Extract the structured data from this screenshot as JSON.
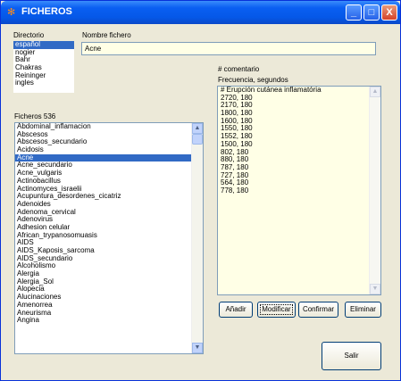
{
  "window": {
    "title": "FICHEROS",
    "icon": "butterfly-icon",
    "minimize": "_",
    "maximize": "□",
    "close": "X"
  },
  "directorio": {
    "label": "Directorio",
    "items": [
      "español",
      "nogier",
      "Bahr",
      "Chakras",
      "Reininger",
      "ingles"
    ],
    "selected": "español"
  },
  "nombre_fichero": {
    "label": "Nombre fichero",
    "value": "Acne"
  },
  "ficheros": {
    "label": "Ficheros 536",
    "items": [
      "Abdominal_inflamacion",
      "Abscesos",
      "Abscesos_secundario",
      "Acidosis",
      "Acne",
      "Acne_secundario",
      "Acne_vulgaris",
      "Actinobacillus",
      "Actinomyces_israelii",
      "Acupuntura_desordenes_cicatriz",
      "Adenoides",
      "Adenoma_cervical",
      "Adenovirus",
      "Adhesion celular",
      "African_trypanosomuasis",
      "AIDS",
      "AIDS_Kaposis_sarcoma",
      "AIDS_secundario",
      "Alcoholismo",
      "Alergia",
      "Alergia_Sol",
      "Alopecia",
      "Alucinaciones",
      "Amenorrea",
      "Aneurisma",
      "Angina"
    ],
    "selected": "Acne"
  },
  "comentario_label": "# comentario",
  "frecuencia_label": "Frecuencia, segundos",
  "memo_lines": [
    "# Erupción cutánea inflamatória",
    "2720, 180",
    "2170, 180",
    "1800, 180",
    "1600, 180",
    "1550, 180",
    "1552, 180",
    "1500, 180",
    "802, 180",
    "880, 180",
    "787, 180",
    "727, 180",
    "564, 180",
    "778, 180"
  ],
  "buttons": {
    "anadir": "Añadir",
    "modificar": "Modificar",
    "confirmar": "Confirmar",
    "eliminar": "Eliminar",
    "salir": "Salir"
  },
  "colors": {
    "titlebar": "#0558e8",
    "selection": "#316ac5",
    "memo_bg": "#ffffe6",
    "input_bg": "#ffffe6",
    "window_bg": "#ece9d8"
  }
}
